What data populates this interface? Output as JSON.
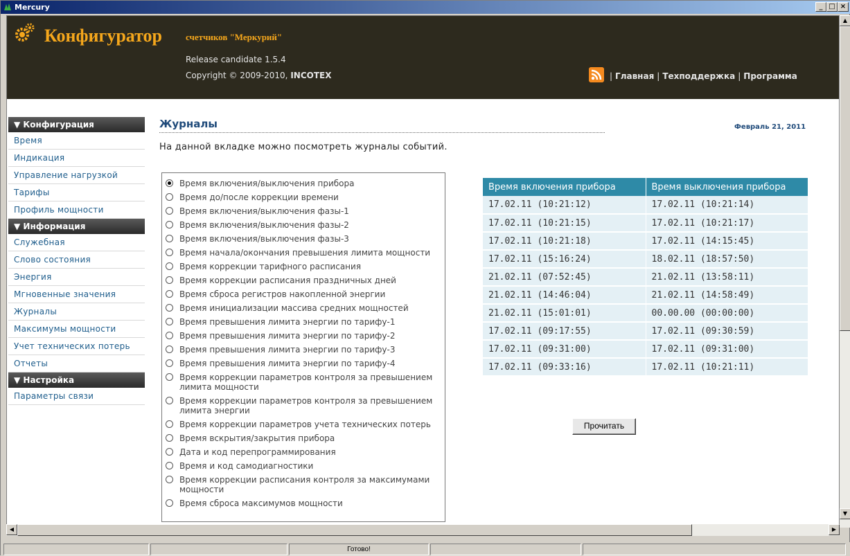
{
  "window": {
    "title": "Mercury",
    "minimize_label": "_",
    "maximize_label": "□",
    "close_label": "×"
  },
  "header": {
    "title": "Конфигуратор",
    "subtitle": "счетчиков \"Меркурий\"",
    "release": "Release candidate 1.5.4",
    "copyright_prefix": "Copyright © 2009-2010, ",
    "copyright_company": "INCOTEX",
    "nav": [
      "Главная",
      "Техподдержка",
      "Программа"
    ],
    "nav_separator": "|"
  },
  "sidebar": {
    "sections": [
      {
        "label": "▼ Конфигурация",
        "items": [
          "Время",
          "Индикация",
          "Управление нагрузкой",
          "Тарифы",
          "Профиль мощности"
        ]
      },
      {
        "label": "▼ Информация",
        "items": [
          "Служебная",
          "Слово состояния",
          "Энергия",
          "Мгновенные значения",
          "Журналы",
          "Максимумы мощности",
          "Учет технических потерь",
          "Отчеты"
        ]
      },
      {
        "label": "▼ Настройка",
        "items": [
          "Параметры связи"
        ]
      }
    ]
  },
  "main": {
    "title": "Журналы",
    "date": "Февраль 21, 2011",
    "description": "На данной вкладке можно посмотреть журналы событий."
  },
  "journals": {
    "selected_index": 0,
    "options": [
      "Время включения/выключения прибора",
      "Время до/после коррекции времени",
      "Время включения/выключения фазы-1",
      "Время включения/выключения фазы-2",
      "Время включения/выключения фазы-3",
      "Время начала/окончания превышения лимита мощности",
      "Время коррекции тарифного расписания",
      "Время коррекции расписания праздничных дней",
      "Время сброса регистров накопленной энергии",
      "Время инициализации массива средних мощностей",
      "Время превышения лимита энергии по тарифу-1",
      "Время превышения лимита энергии по тарифу-2",
      "Время превышения лимита энергии по тарифу-3",
      "Время превышения лимита энергии по тарифу-4",
      "Время коррекции параметров контроля за превышением лимита мощности",
      "Время коррекции параметров контроля за превышением лимита энергии",
      "Время коррекции параметров учета технических потерь",
      "Время вскрытия/закрытия прибора",
      "Дата и код перепрограммирования",
      "Время и код самодиагностики",
      "Время коррекции расписания контроля за максимумами мощности",
      "Время сброса максимумов мощности"
    ]
  },
  "log_table": {
    "headers": [
      "Время включения прибора",
      "Время выключения прибора"
    ],
    "rows": [
      [
        "17.02.11 (10:21:12)",
        "17.02.11 (10:21:14)"
      ],
      [
        "17.02.11 (10:21:15)",
        "17.02.11 (10:21:17)"
      ],
      [
        "17.02.11 (10:21:18)",
        "17.02.11 (14:15:45)"
      ],
      [
        "17.02.11 (15:16:24)",
        "18.02.11 (18:57:50)"
      ],
      [
        "21.02.11 (07:52:45)",
        "21.02.11 (13:58:11)"
      ],
      [
        "21.02.11 (14:46:04)",
        "21.02.11 (14:58:49)"
      ],
      [
        "21.02.11 (15:01:01)",
        "00.00.00 (00:00:00)"
      ],
      [
        "17.02.11 (09:17:55)",
        "17.02.11 (09:30:59)"
      ],
      [
        "17.02.11 (09:31:00)",
        "17.02.11 (09:31:00)"
      ],
      [
        "17.02.11 (09:33:16)",
        "17.02.11 (10:21:11)"
      ]
    ]
  },
  "read_button": "Прочитать",
  "status": {
    "text": "Готово!"
  }
}
